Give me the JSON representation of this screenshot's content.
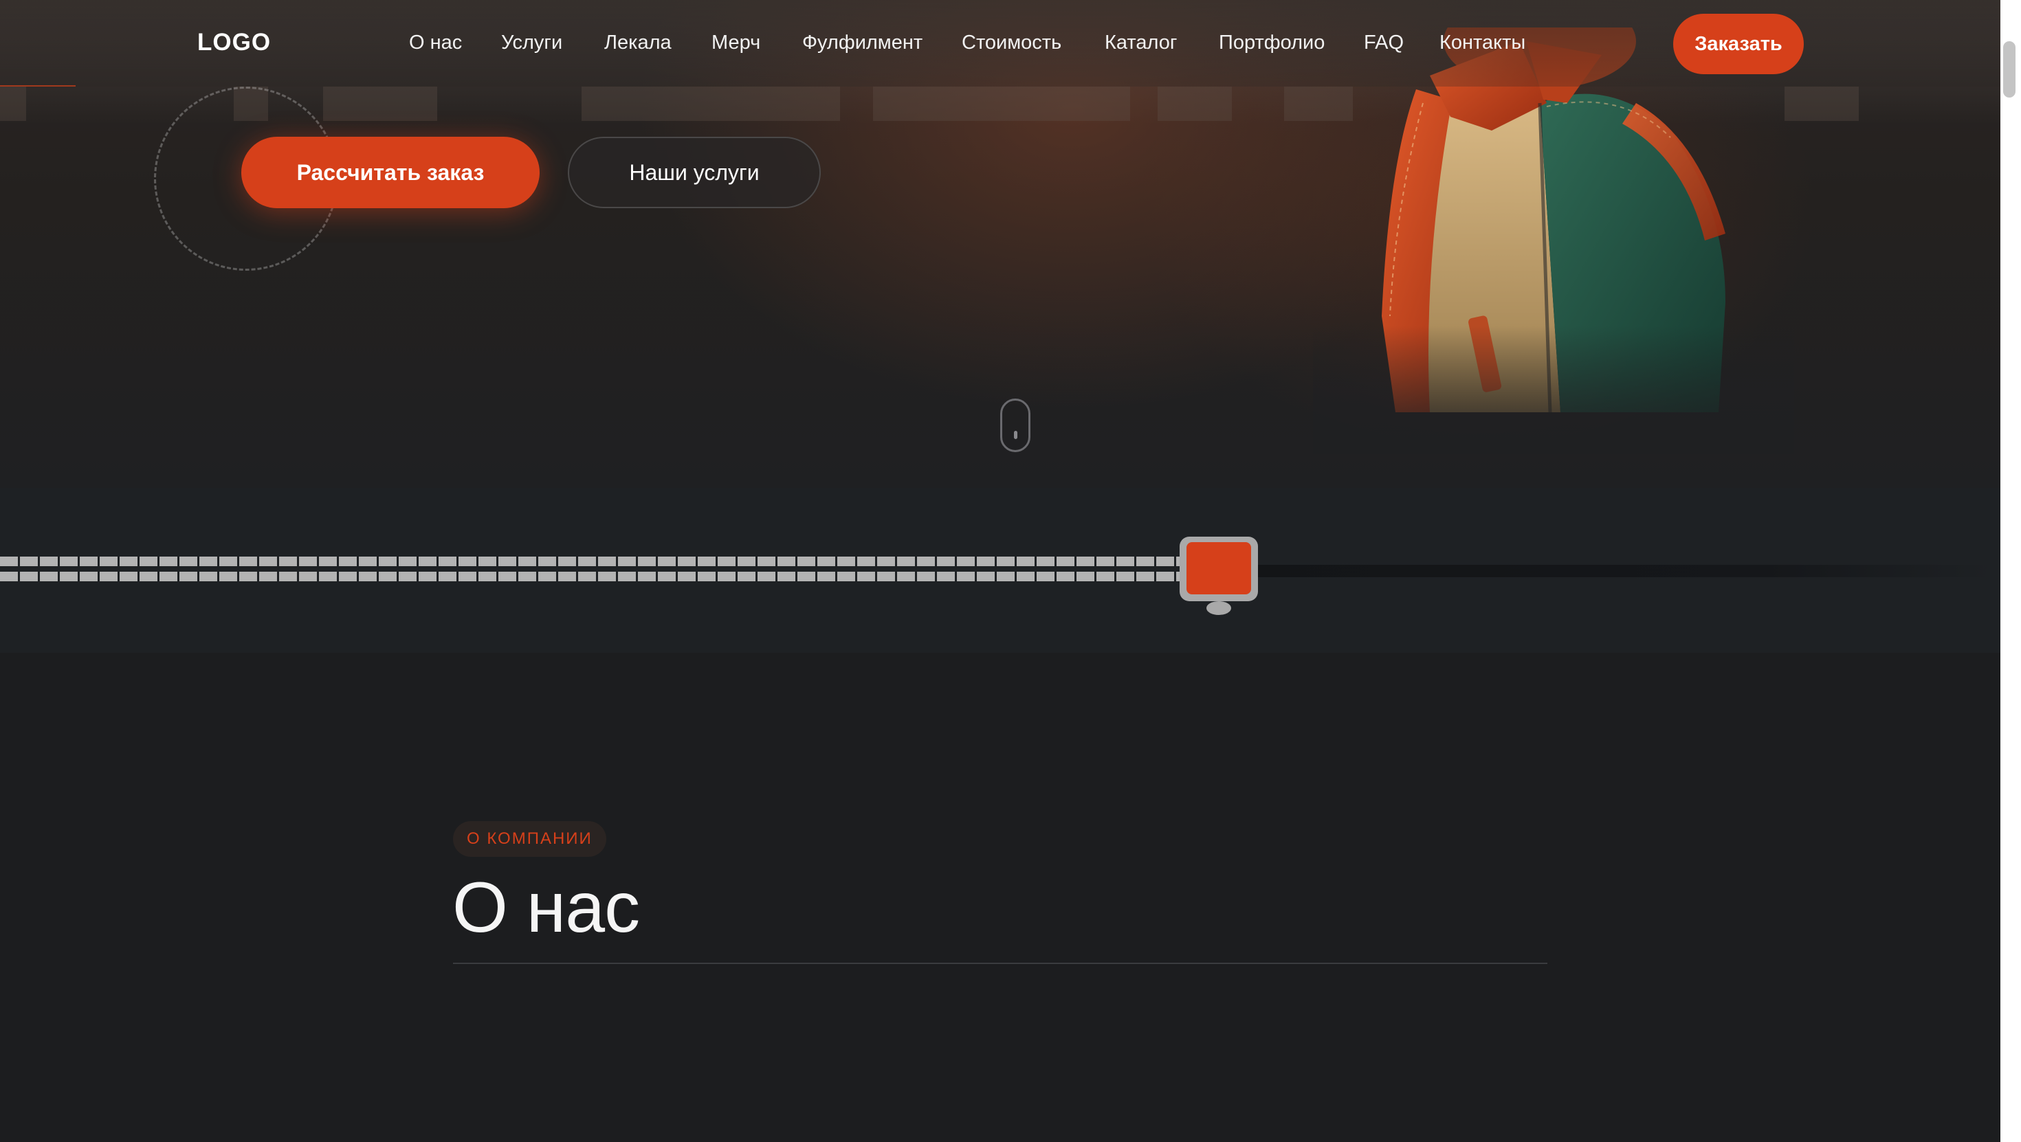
{
  "header": {
    "logo": "LOGO",
    "nav": [
      {
        "label": "О нас"
      },
      {
        "label": "Услуги"
      },
      {
        "label": "Лекала"
      },
      {
        "label": "Мерч"
      },
      {
        "label": "Фулфилмент"
      },
      {
        "label": "Стоимость"
      },
      {
        "label": "Каталог"
      },
      {
        "label": "Портфолио"
      },
      {
        "label": "FAQ"
      },
      {
        "label": "Контакты"
      }
    ],
    "order_label": "Заказать"
  },
  "hero": {
    "primary_label": "Рассчитать заказ",
    "secondary_label": "Наши услуги"
  },
  "progress": {
    "fraction": 0.6
  },
  "about": {
    "badge": "О КОМПАНИИ",
    "title": "О нас"
  },
  "colors": {
    "accent": "#d6401a",
    "background": "#1c1d1f"
  },
  "icons": {
    "scroll": "mouse-scroll-icon",
    "zipper": "zipper-puller-icon"
  }
}
